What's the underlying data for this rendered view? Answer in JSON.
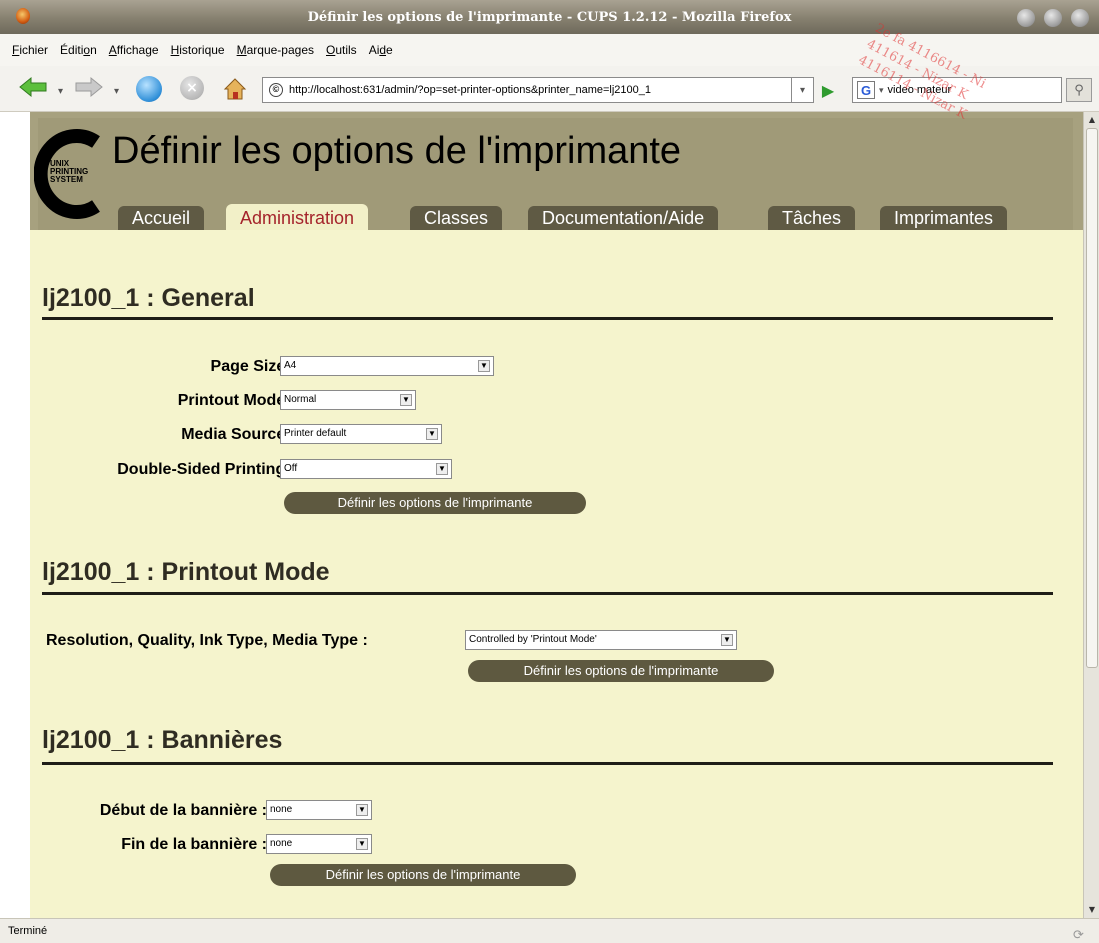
{
  "window": {
    "title": "Définir les options de l'imprimante - CUPS 1.2.12 - Mozilla Firefox"
  },
  "menu": [
    {
      "label": "Fichier",
      "mnemonic_index": 0
    },
    {
      "label": "Édition",
      "mnemonic_index": 5
    },
    {
      "label": "Affichage",
      "mnemonic_index": 0
    },
    {
      "label": "Historique",
      "mnemonic_index": 0
    },
    {
      "label": "Marque-pages",
      "mnemonic_index": 0
    },
    {
      "label": "Outils",
      "mnemonic_index": 0
    },
    {
      "label": "Aide",
      "mnemonic_index": 2
    }
  ],
  "navbar": {
    "url": "http://localhost:631/admin/?op=set-printer-options&printer_name=lj2100_1",
    "search_value": "video mateur",
    "search_engine_icon": "G"
  },
  "page": {
    "heading": "Définir les options de l'imprimante",
    "logo_text": [
      "UNIX",
      "PRINTING",
      "SYSTEM"
    ],
    "tabs": [
      {
        "label": "Accueil",
        "active": false
      },
      {
        "label": "Administration",
        "active": true
      },
      {
        "label": "Classes",
        "active": false
      },
      {
        "label": "Documentation/Aide",
        "active": false
      },
      {
        "label": "Tâches",
        "active": false
      },
      {
        "label": "Imprimantes",
        "active": false
      }
    ],
    "sections": {
      "general": {
        "title": "lj2100_1 : General",
        "fields": [
          {
            "label": "Page Size :",
            "value": "A4"
          },
          {
            "label": "Printout Mode :",
            "value": "Normal"
          },
          {
            "label": "Media Source :",
            "value": "Printer default"
          },
          {
            "label": "Double-Sided Printing :",
            "value": "Off"
          }
        ],
        "button": "Définir les options de l'imprimante"
      },
      "printout": {
        "title": "lj2100_1 : Printout Mode",
        "fields": [
          {
            "label": "Resolution, Quality, Ink Type, Media Type :",
            "value": "Controlled by 'Printout Mode'"
          }
        ],
        "button": "Définir les options de l'imprimante"
      },
      "banners": {
        "title": "lj2100_1 : Bannières",
        "fields": [
          {
            "label": "Début de la bannière :",
            "value": "none"
          },
          {
            "label": "Fin de la bannière :",
            "value": "none"
          }
        ],
        "button": "Définir les options de l'imprimante"
      }
    }
  },
  "status": {
    "text": "Terminé"
  },
  "watermark": [
    "2e fa 4116614 - Ni",
    "411614 - Nizar K",
    "4116114 - Nizar K"
  ]
}
